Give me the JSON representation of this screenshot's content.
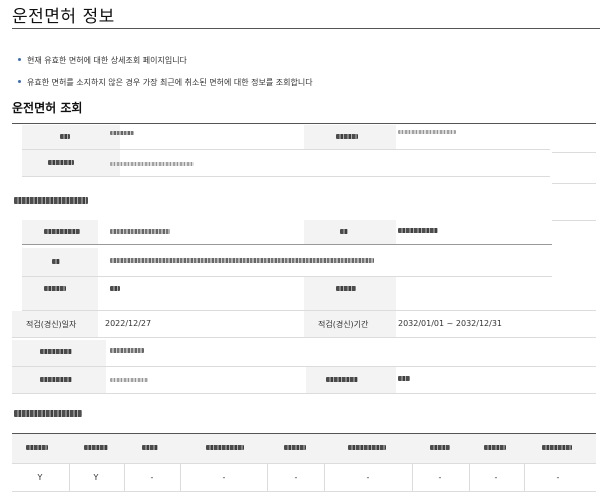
{
  "page": {
    "title": "운전면허 정보"
  },
  "notices": [
    "현재 유효한 면허에 대한 상세조회 페이지입니다",
    "유효한 면허를 소지하지 않은 경우 가장 최근에 취소된 면허에 대한 정보를 조회합니다"
  ],
  "license_inquiry": {
    "section_title": "운전면허 조회",
    "issue_date_label": "적검(경신)일자",
    "issue_date_value": "2022/12/27",
    "period_label": "적검(경신)기간",
    "period_value": "2032/01/01 ~ 2032/12/31"
  },
  "check_table": {
    "row_values": [
      "Y",
      "Y",
      "-",
      "-",
      "-",
      "-",
      "-",
      "-",
      "-"
    ]
  },
  "colors": {
    "rule_dark": "#555555",
    "cell_bg": "#f3f3f3",
    "bullet": "#3b6fb6"
  }
}
